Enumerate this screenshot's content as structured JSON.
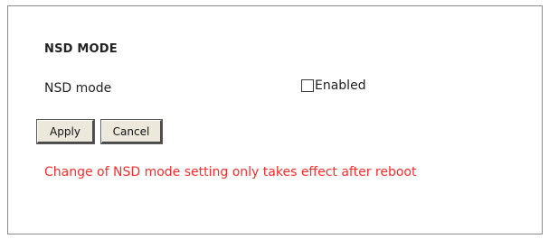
{
  "section": {
    "title": "NSD MODE"
  },
  "setting": {
    "label": "NSD mode",
    "checkbox_label": "Enabled",
    "checked": false
  },
  "buttons": {
    "apply_label": "Apply",
    "cancel_label": "Cancel"
  },
  "notice": {
    "text": "Change of NSD mode setting only takes effect after reboot",
    "color": "#ff2a2a"
  }
}
